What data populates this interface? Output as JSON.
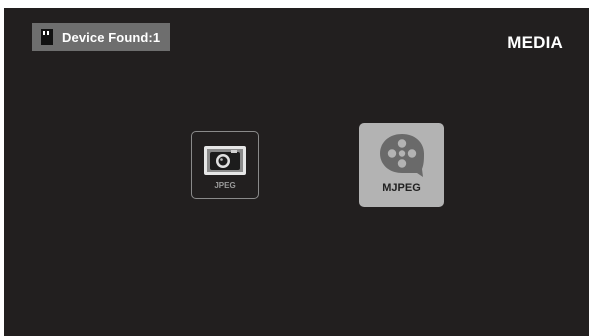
{
  "header": {
    "device_status": "Device Found:1",
    "device_icon": "sd-card-icon",
    "title": "MEDIA"
  },
  "media_types": [
    {
      "label": "JPEG",
      "icon": "camera-icon",
      "selected": false
    },
    {
      "label": "MJPEG",
      "icon": "film-reel-icon",
      "selected": true
    }
  ],
  "colors": {
    "background": "#221f1f",
    "badge": "#6e6e6e",
    "selected_tile": "#b3b3b3",
    "text": "#ffffff"
  }
}
